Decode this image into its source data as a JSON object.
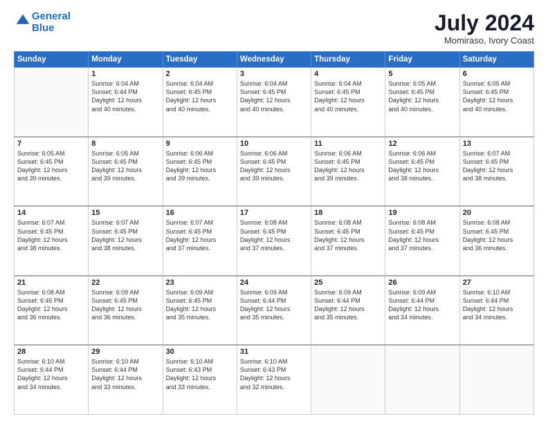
{
  "header": {
    "logo_line1": "General",
    "logo_line2": "Blue",
    "title": "July 2024",
    "subtitle": "Momiraso, Ivory Coast"
  },
  "weekdays": [
    "Sunday",
    "Monday",
    "Tuesday",
    "Wednesday",
    "Thursday",
    "Friday",
    "Saturday"
  ],
  "weeks": [
    [
      {
        "day": "",
        "info": ""
      },
      {
        "day": "1",
        "info": "Sunrise: 6:04 AM\nSunset: 6:44 PM\nDaylight: 12 hours\nand 40 minutes."
      },
      {
        "day": "2",
        "info": "Sunrise: 6:04 AM\nSunset: 6:45 PM\nDaylight: 12 hours\nand 40 minutes."
      },
      {
        "day": "3",
        "info": "Sunrise: 6:04 AM\nSunset: 6:45 PM\nDaylight: 12 hours\nand 40 minutes."
      },
      {
        "day": "4",
        "info": "Sunrise: 6:04 AM\nSunset: 6:45 PM\nDaylight: 12 hours\nand 40 minutes."
      },
      {
        "day": "5",
        "info": "Sunrise: 6:05 AM\nSunset: 6:45 PM\nDaylight: 12 hours\nand 40 minutes."
      },
      {
        "day": "6",
        "info": "Sunrise: 6:05 AM\nSunset: 6:45 PM\nDaylight: 12 hours\nand 40 minutes."
      }
    ],
    [
      {
        "day": "7",
        "info": "Sunrise: 6:05 AM\nSunset: 6:45 PM\nDaylight: 12 hours\nand 39 minutes."
      },
      {
        "day": "8",
        "info": "Sunrise: 6:05 AM\nSunset: 6:45 PM\nDaylight: 12 hours\nand 39 minutes."
      },
      {
        "day": "9",
        "info": "Sunrise: 6:06 AM\nSunset: 6:45 PM\nDaylight: 12 hours\nand 39 minutes."
      },
      {
        "day": "10",
        "info": "Sunrise: 6:06 AM\nSunset: 6:45 PM\nDaylight: 12 hours\nand 39 minutes."
      },
      {
        "day": "11",
        "info": "Sunrise: 6:06 AM\nSunset: 6:45 PM\nDaylight: 12 hours\nand 39 minutes."
      },
      {
        "day": "12",
        "info": "Sunrise: 6:06 AM\nSunset: 6:45 PM\nDaylight: 12 hours\nand 38 minutes."
      },
      {
        "day": "13",
        "info": "Sunrise: 6:07 AM\nSunset: 6:45 PM\nDaylight: 12 hours\nand 38 minutes."
      }
    ],
    [
      {
        "day": "14",
        "info": "Sunrise: 6:07 AM\nSunset: 6:45 PM\nDaylight: 12 hours\nand 38 minutes."
      },
      {
        "day": "15",
        "info": "Sunrise: 6:07 AM\nSunset: 6:45 PM\nDaylight: 12 hours\nand 38 minutes."
      },
      {
        "day": "16",
        "info": "Sunrise: 6:07 AM\nSunset: 6:45 PM\nDaylight: 12 hours\nand 37 minutes."
      },
      {
        "day": "17",
        "info": "Sunrise: 6:08 AM\nSunset: 6:45 PM\nDaylight: 12 hours\nand 37 minutes."
      },
      {
        "day": "18",
        "info": "Sunrise: 6:08 AM\nSunset: 6:45 PM\nDaylight: 12 hours\nand 37 minutes."
      },
      {
        "day": "19",
        "info": "Sunrise: 6:08 AM\nSunset: 6:45 PM\nDaylight: 12 hours\nand 37 minutes."
      },
      {
        "day": "20",
        "info": "Sunrise: 6:08 AM\nSunset: 6:45 PM\nDaylight: 12 hours\nand 36 minutes."
      }
    ],
    [
      {
        "day": "21",
        "info": "Sunrise: 6:08 AM\nSunset: 6:45 PM\nDaylight: 12 hours\nand 36 minutes."
      },
      {
        "day": "22",
        "info": "Sunrise: 6:09 AM\nSunset: 6:45 PM\nDaylight: 12 hours\nand 36 minutes."
      },
      {
        "day": "23",
        "info": "Sunrise: 6:09 AM\nSunset: 6:45 PM\nDaylight: 12 hours\nand 35 minutes."
      },
      {
        "day": "24",
        "info": "Sunrise: 6:09 AM\nSunset: 6:44 PM\nDaylight: 12 hours\nand 35 minutes."
      },
      {
        "day": "25",
        "info": "Sunrise: 6:09 AM\nSunset: 6:44 PM\nDaylight: 12 hours\nand 35 minutes."
      },
      {
        "day": "26",
        "info": "Sunrise: 6:09 AM\nSunset: 6:44 PM\nDaylight: 12 hours\nand 34 minutes."
      },
      {
        "day": "27",
        "info": "Sunrise: 6:10 AM\nSunset: 6:44 PM\nDaylight: 12 hours\nand 34 minutes."
      }
    ],
    [
      {
        "day": "28",
        "info": "Sunrise: 6:10 AM\nSunset: 6:44 PM\nDaylight: 12 hours\nand 34 minutes."
      },
      {
        "day": "29",
        "info": "Sunrise: 6:10 AM\nSunset: 6:44 PM\nDaylight: 12 hours\nand 33 minutes."
      },
      {
        "day": "30",
        "info": "Sunrise: 6:10 AM\nSunset: 6:43 PM\nDaylight: 12 hours\nand 33 minutes."
      },
      {
        "day": "31",
        "info": "Sunrise: 6:10 AM\nSunset: 6:43 PM\nDaylight: 12 hours\nand 32 minutes."
      },
      {
        "day": "",
        "info": ""
      },
      {
        "day": "",
        "info": ""
      },
      {
        "day": "",
        "info": ""
      }
    ]
  ]
}
